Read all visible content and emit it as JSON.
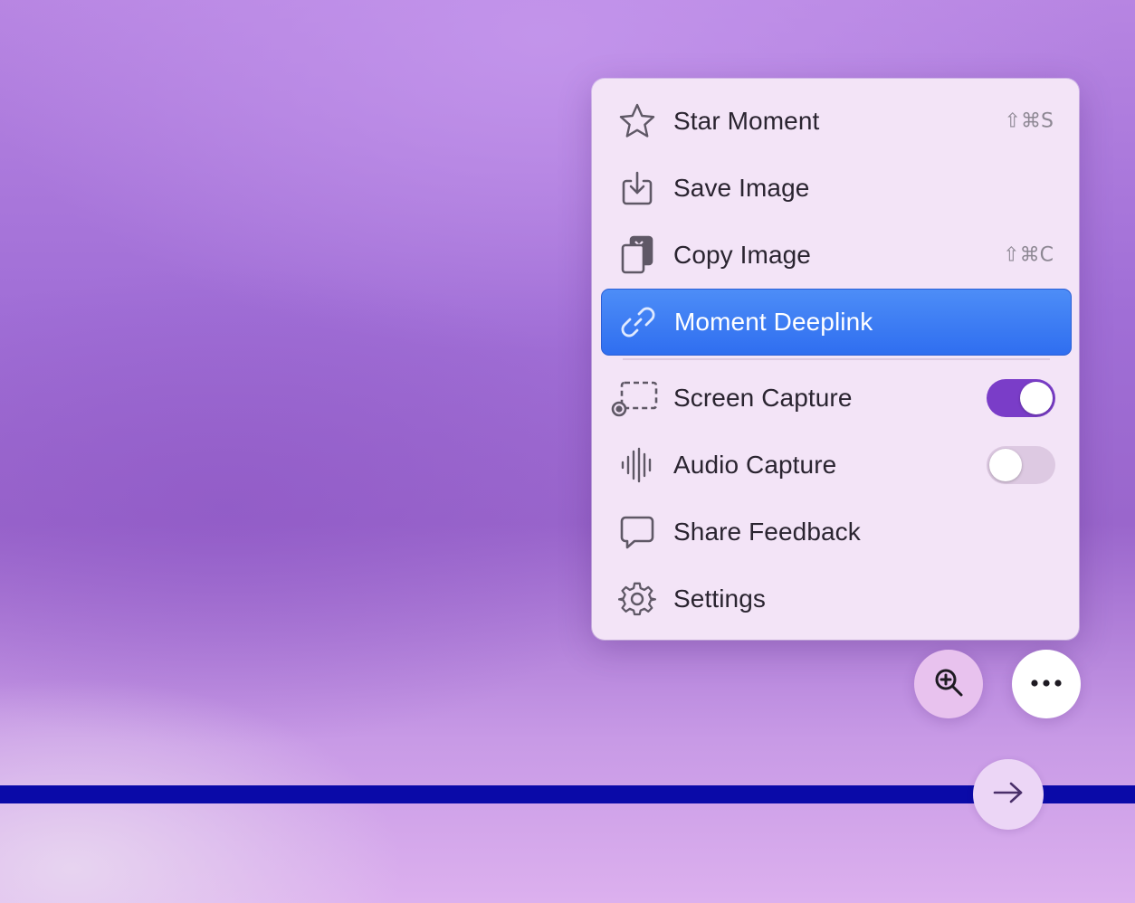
{
  "menu": {
    "items": [
      {
        "label": "Star Moment",
        "shortcut": "⇧⌘S",
        "icon": "star-icon"
      },
      {
        "label": "Save Image",
        "shortcut": "",
        "icon": "download-icon"
      },
      {
        "label": "Copy Image",
        "shortcut": "⇧⌘C",
        "icon": "copy-icon"
      },
      {
        "label": "Moment Deeplink",
        "shortcut": "",
        "icon": "link-icon",
        "highlighted": true
      },
      {
        "label": "Screen Capture",
        "icon": "screen-capture-icon",
        "toggle": true,
        "enabled": true
      },
      {
        "label": "Audio Capture",
        "icon": "waveform-icon",
        "toggle": true,
        "enabled": false
      },
      {
        "label": "Share Feedback",
        "icon": "speech-bubble-icon"
      },
      {
        "label": "Settings",
        "icon": "gear-icon"
      }
    ]
  },
  "controls": {
    "zoom_icon": "zoom-in-icon",
    "more_icon": "ellipsis-icon",
    "next_icon": "arrow-right-icon"
  },
  "colors": {
    "highlight": "#3a7cf4",
    "toggle_on": "#7a3dc8",
    "toggle_off": "#ddc9e2",
    "timeline_bar": "#0a0aa8"
  }
}
